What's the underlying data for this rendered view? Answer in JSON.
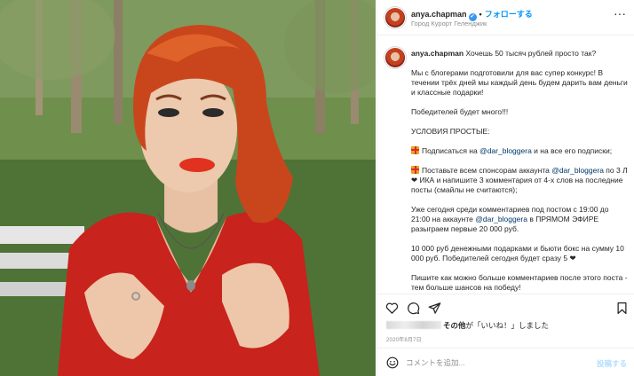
{
  "header": {
    "username": "anya.chapman",
    "verified_badge": "✔",
    "separator": "•",
    "follow_label": "フォローする",
    "location": "Город Курорт Геленджик",
    "more_label": "···"
  },
  "caption": {
    "username": "anya.chapman",
    "first_line": "Хочешь 50 тысяч рублей просто так?",
    "para1": "Мы с блогерами подготовили для вас супер конкурс! В течении трёх дней мы каждый день будем дарить вам деньги и классные подарки!",
    "para2": "Победителей будет много!!!",
    "para3": "УСЛОВИЯ ПРОСТЫЕ:",
    "cond1_pre": "Подписаться на ",
    "cond1_mention": "@dar_bloggera",
    "cond1_post": " и на все его подписки;",
    "cond2_pre": "Поставьте всем спонсорам аккаунта ",
    "cond2_mention": "@dar_bloggera",
    "cond2_post": " по 3 Л❤ ИКА и напишите 3 комментария от 4-х слов на последние посты (смайлы не считаются);",
    "para4_pre": "Уже сегодня среди комментариев под постом с 19:00 до 21:00 на аккаунте ",
    "para4_mention": "@dar_bloggera",
    "para4_post": " в ПРЯМОМ ЭФИРЕ разыграем первые 20 000 руб.",
    "para5": "10 000 руб денежными подарками и бьюти бокс на сумму 10 000 руб. Победителей сегодня будет сразу 5 ❤",
    "para6": "Пишите как можно больше комментариев после этого поста - тем больше шансов на победу!"
  },
  "actions": {
    "icons": [
      "heart-icon",
      "comment-icon",
      "share-icon",
      "bookmark-icon"
    ]
  },
  "likes": {
    "suffix_bold": "その他",
    "suffix_rest": "が「いいね！」しました"
  },
  "date": "2020年8月7日",
  "comment": {
    "placeholder": "コメントを追加...",
    "post_label": "投稿する"
  },
  "colors": {
    "accent": "#0095f6",
    "mention": "#00376b",
    "muted": "#8e8e8e",
    "post_disabled": "#b2dffc"
  }
}
